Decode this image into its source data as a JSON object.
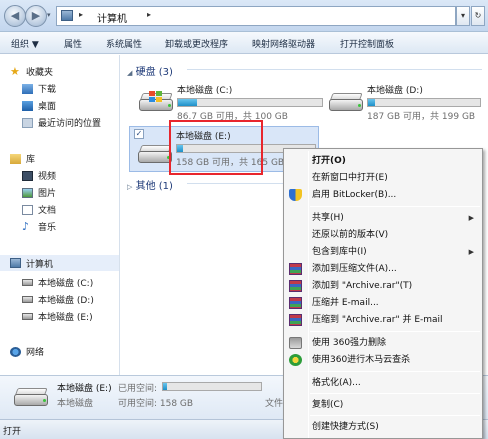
{
  "address": {
    "breadcrumb": "计算机",
    "separator": "▸",
    "dropdown": "▾",
    "refresh": "↻"
  },
  "nav_buttons": {
    "back": "◀",
    "forward": "▶"
  },
  "toolbar": {
    "organize": "组织 ▼",
    "properties": "属性",
    "system_properties": "系统属性",
    "uninstall": "卸载或更改程序",
    "map_drive": "映射网络驱动器",
    "control_panel": "打开控制面板"
  },
  "sidebar": {
    "favorites": "收藏夹",
    "downloads": "下载",
    "desktop": "桌面",
    "recent": "最近访问的位置",
    "libraries": "库",
    "videos": "视频",
    "pictures": "图片",
    "documents": "文档",
    "music": "音乐",
    "computer": "计算机",
    "drive_c": "本地磁盘 (C:)",
    "drive_d": "本地磁盘 (D:)",
    "drive_e": "本地磁盘 (E:)",
    "network": "网络"
  },
  "groups": {
    "hard_disks": "硬盘 (3)",
    "other": "其他 (1)",
    "collapse_icon": "◢",
    "expand_icon": "▷"
  },
  "drives": [
    {
      "name": "本地磁盘 (C:)",
      "summary": "86.7 GB 可用，共 100 GB",
      "used_fraction": 0.133,
      "icon": "windows-drive-icon"
    },
    {
      "name": "本地磁盘 (D:)",
      "summary": "187 GB 可用，共 199 GB",
      "used_fraction": 0.06,
      "icon": "hard-drive-icon"
    },
    {
      "name": "本地磁盘 (E:)",
      "summary": "158 GB 可用，共 165 GB",
      "used_fraction": 0.042,
      "icon": "hard-drive-icon",
      "checkbox": "✓"
    }
  ],
  "details": {
    "name": "本地磁盘 (E:)",
    "used_label": "已用空间:",
    "type": "本地磁盘",
    "free_label": "可用空间: 158 GB",
    "file_label": "文件",
    "used_fraction": 0.042
  },
  "status": {
    "text": "打开"
  },
  "context_menu": {
    "open": "打开(O)",
    "open_new_window": "在新窗口中打开(E)",
    "bitlocker": "启用 BitLocker(B)...",
    "share": "共享(H)",
    "restore": "还原以前的版本(V)",
    "include_library": "包含到库中(I)",
    "add_archive": "添加到压缩文件(A)...",
    "add_archive_rar": "添加到 \"Archive.rar\"(T)",
    "compress_email": "压缩并 E-mail...",
    "compress_rar_email": "压缩到 \"Archive.rar\" 并 E-mail",
    "force_delete": "使用 360强力删除",
    "trojan_scan": "使用360进行木马云查杀",
    "format": "格式化(A)...",
    "copy": "复制(C)",
    "shortcut": "创建快捷方式(S)",
    "submenu_arrow": "▶"
  },
  "colors": {
    "highlight_box": "#e8262d",
    "progress": "#1e8fc8",
    "group_text": "#1e3a78"
  }
}
